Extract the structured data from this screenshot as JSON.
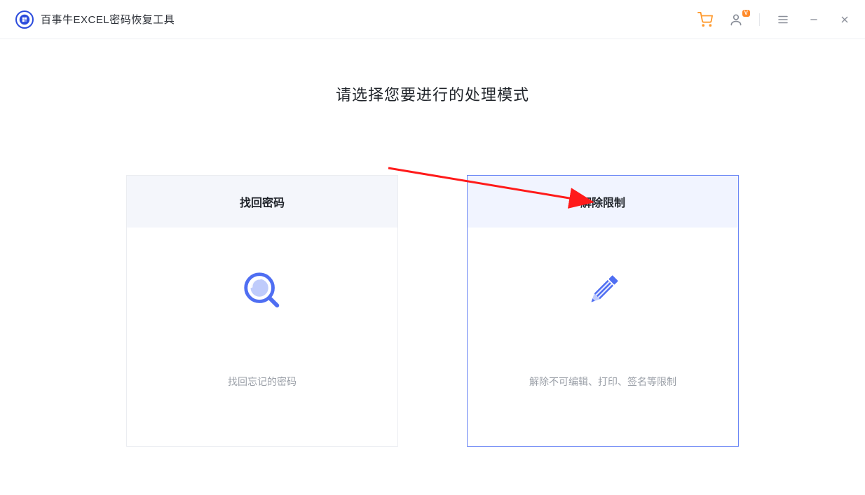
{
  "app": {
    "title": "百事牛EXCEL密码恢复工具"
  },
  "titlebar": {
    "cart_icon": "shopping-cart",
    "user_icon": "user",
    "vip_badge": "V",
    "menu_icon": "menu",
    "minimize_icon": "minimize",
    "close_icon": "close"
  },
  "main": {
    "heading": "请选择您要进行的处理模式",
    "cards": [
      {
        "title": "找回密码",
        "desc": "找回忘记的密码",
        "icon": "magnifier",
        "selected": false
      },
      {
        "title": "解除限制",
        "desc": "解除不可编辑、打印、签名等限制",
        "icon": "pencil",
        "selected": true
      }
    ]
  },
  "colors": {
    "accent": "#6b87f5",
    "icon_blue": "#4f6ef2",
    "cart_orange": "#ff9a2e"
  }
}
